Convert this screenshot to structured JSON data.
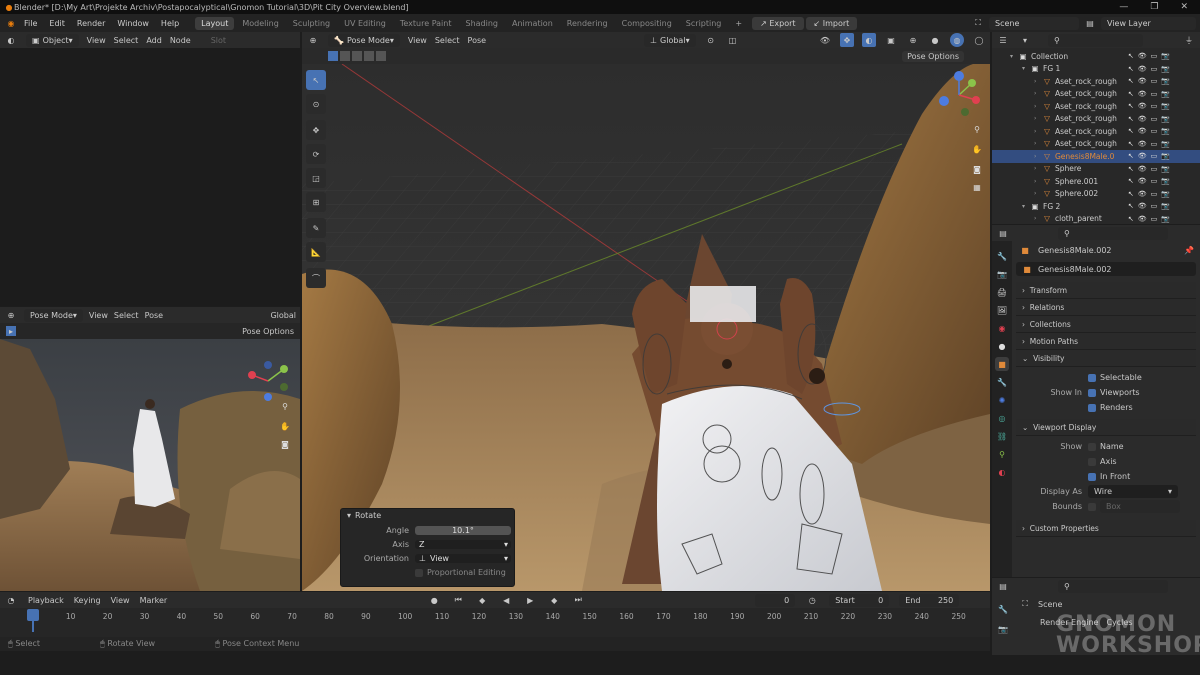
{
  "title_bar": {
    "text": "Blender* [D:\\My Art\\Projekte Archiv\\Postapocalyptical\\Gnomon Tutorial\\3D\\Pit City Overview.blend]",
    "controls": [
      "—",
      "❐",
      "✕"
    ]
  },
  "menu": [
    "File",
    "Edit",
    "Render",
    "Window",
    "Help"
  ],
  "workspaces": [
    "Layout",
    "Modeling",
    "Sculpting",
    "UV Editing",
    "Texture Paint",
    "Shading",
    "Animation",
    "Rendering",
    "Compositing",
    "Scripting"
  ],
  "export_label": "Export",
  "import_label": "Import",
  "scene": "Scene",
  "view_layer": "View Layer",
  "node_header": {
    "mode": "Object",
    "items": [
      "View",
      "Select",
      "Add",
      "Node"
    ],
    "slot": "Slot"
  },
  "main_vp": {
    "mode": "Pose Mode",
    "items": [
      "View",
      "Select",
      "Pose"
    ],
    "orientation": "Global",
    "options": "Pose Options"
  },
  "small_vp": {
    "mode": "Pose Mode",
    "items": [
      "View",
      "Select",
      "Pose"
    ],
    "orientation": "Global",
    "options": "Pose Options"
  },
  "rotate_panel": {
    "title": "Rotate",
    "angle_label": "Angle",
    "angle": "10.1°",
    "axis_label": "Axis",
    "axis": "Z",
    "orientation_label": "Orientation",
    "orientation": "View",
    "proportional": "Proportional Editing"
  },
  "outliner": [
    {
      "name": "Collection",
      "level": 0
    },
    {
      "name": "FG 1",
      "level": 1
    },
    {
      "name": "Aset_rock_rough",
      "level": 2
    },
    {
      "name": "Aset_rock_rough",
      "level": 2
    },
    {
      "name": "Aset_rock_rough",
      "level": 2
    },
    {
      "name": "Aset_rock_rough",
      "level": 2
    },
    {
      "name": "Aset_rock_rough",
      "level": 2
    },
    {
      "name": "Aset_rock_rough",
      "level": 2
    },
    {
      "name": "Genesis8Male.0",
      "level": 2,
      "selected": true
    },
    {
      "name": "Sphere",
      "level": 2
    },
    {
      "name": "Sphere.001",
      "level": 2
    },
    {
      "name": "Sphere.002",
      "level": 2
    },
    {
      "name": "FG 2",
      "level": 1
    },
    {
      "name": "cloth_parent",
      "level": 2
    }
  ],
  "props": {
    "object_name": "Genesis8Male.002",
    "data_name": "Genesis8Male.002",
    "sections": [
      "Transform",
      "Relations",
      "Collections",
      "Motion Paths"
    ],
    "visibility": "Visibility",
    "selectable": "Selectable",
    "show_in": "Show In",
    "viewports": "Viewports",
    "renders": "Renders",
    "viewport_display": "Viewport Display",
    "show": "Show",
    "name": "Name",
    "axis": "Axis",
    "in_front": "In Front",
    "display_as_label": "Display As",
    "display_as": "Wire",
    "bounds_label": "Bounds",
    "bounds": "Box",
    "custom": "Custom Properties"
  },
  "timeline": {
    "items": [
      "Playback",
      "Keying",
      "View",
      "Marker"
    ],
    "current": "0",
    "start_label": "Start",
    "start": "0",
    "end_label": "End",
    "end": "250",
    "ticks": [
      "0",
      "10",
      "20",
      "30",
      "40",
      "50",
      "60",
      "70",
      "80",
      "90",
      "100",
      "110",
      "120",
      "130",
      "140",
      "150",
      "160",
      "170",
      "180",
      "190",
      "200",
      "210",
      "220",
      "230",
      "240",
      "250"
    ]
  },
  "status": [
    "Select",
    "Rotate View",
    "Pose Context Menu"
  ],
  "bottom_props": {
    "scene": "Scene",
    "render_engine_label": "Render Engine",
    "render_engine": "Cycles"
  },
  "watermark": [
    "GNOMON",
    "WORKSHOP"
  ],
  "colors": {
    "accent": "#4772b3",
    "selected_row": "#334d80",
    "orange": "#e08a3a"
  }
}
